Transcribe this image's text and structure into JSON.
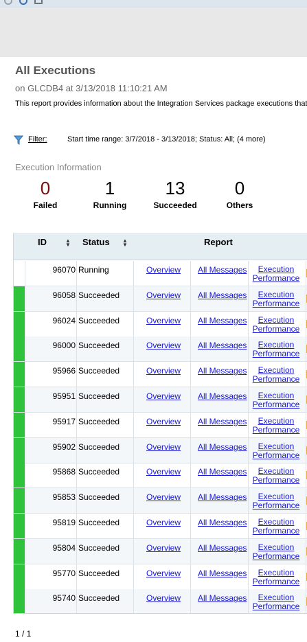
{
  "report": {
    "title": "All Executions",
    "subtitle": "on GLCDB4 at 3/13/2018 11:10:21 AM",
    "description": "This report provides information about the Integration Services package executions that ha"
  },
  "filter": {
    "label": "Filter:",
    "summary": "Start time range: 3/7/2018 - 3/13/2018;  Status: All;  (4 more)"
  },
  "execution_info": {
    "title": "Execution Information",
    "stats": [
      {
        "value": "0",
        "label": "Failed"
      },
      {
        "value": "1",
        "label": "Running"
      },
      {
        "value": "13",
        "label": "Succeeded"
      },
      {
        "value": "0",
        "label": "Others"
      }
    ]
  },
  "grid": {
    "headers": {
      "id": "ID",
      "status": "Status",
      "report": "Report"
    },
    "link_labels": {
      "overview": "Overview",
      "all_messages": "All Messages",
      "execution": "Execution",
      "performance": "Performance"
    },
    "rows": [
      {
        "id": "96070",
        "status": "Running"
      },
      {
        "id": "96058",
        "status": "Succeeded"
      },
      {
        "id": "96024",
        "status": "Succeeded"
      },
      {
        "id": "96000",
        "status": "Succeeded"
      },
      {
        "id": "95966",
        "status": "Succeeded"
      },
      {
        "id": "95951",
        "status": "Succeeded"
      },
      {
        "id": "95917",
        "status": "Succeeded"
      },
      {
        "id": "95902",
        "status": "Succeeded"
      },
      {
        "id": "95868",
        "status": "Succeeded"
      },
      {
        "id": "95853",
        "status": "Succeeded"
      },
      {
        "id": "95819",
        "status": "Succeeded"
      },
      {
        "id": "95804",
        "status": "Succeeded"
      },
      {
        "id": "95770",
        "status": "Succeeded"
      },
      {
        "id": "95740",
        "status": "Succeeded"
      }
    ]
  },
  "pager": {
    "text": "1 / 1"
  },
  "colors": {
    "succeeded": "#2ec33a",
    "failed_count": "#7a0c0c",
    "link": "#1a1ad8"
  }
}
